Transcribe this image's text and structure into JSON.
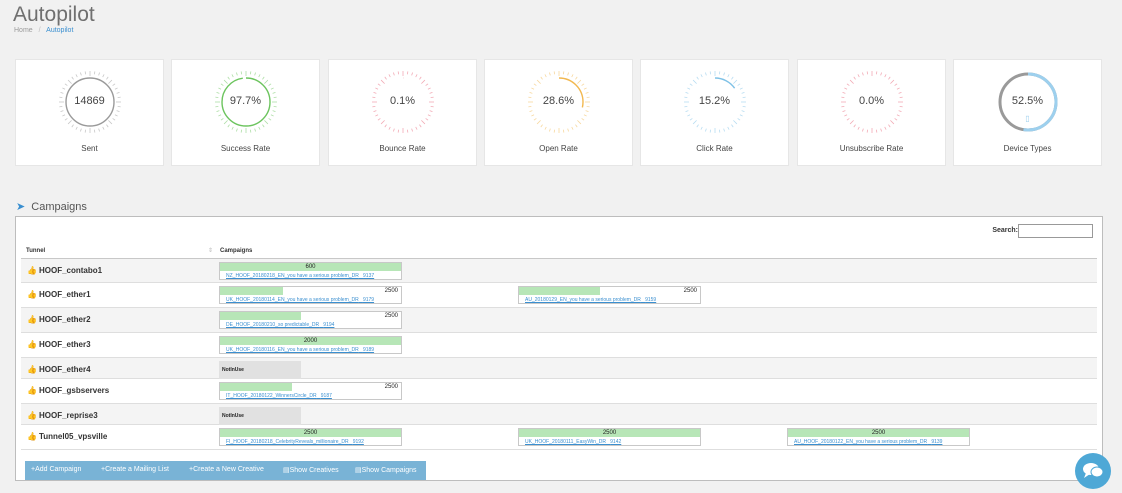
{
  "page": {
    "title": "Autopilot"
  },
  "breadcrumb": {
    "home": "Home",
    "separator": "/",
    "current": "Autopilot"
  },
  "stats": [
    {
      "value": "14869",
      "label": "Sent",
      "color": "#9a9a9a",
      "fill_fraction": 1.0
    },
    {
      "value": "97.7%",
      "label": "Success Rate",
      "color": "#6cc45e",
      "fill_fraction": 0.977
    },
    {
      "value": "0.1%",
      "label": "Bounce Rate",
      "color": "#e8657a",
      "fill_fraction": 0.001
    },
    {
      "value": "28.6%",
      "label": "Open Rate",
      "color": "#f2b84f",
      "fill_fraction": 0.286
    },
    {
      "value": "15.2%",
      "label": "Click Rate",
      "color": "#7ec1e6",
      "fill_fraction": 0.152
    },
    {
      "value": "0.0%",
      "label": "Unsubscribe Rate",
      "color": "#e8657a",
      "fill_fraction": 0.0
    },
    {
      "value": "52.5%",
      "label": "Device Types",
      "color": "#9dd0ee",
      "secondary_color": "#9a9a9a",
      "fill_fraction": 0.525,
      "icon": "mobile-icon"
    }
  ],
  "campaigns_section": {
    "title": "Campaigns",
    "icon": "paper-plane-icon"
  },
  "search": {
    "label": "Search:"
  },
  "table": {
    "headers": {
      "tunnel": "Tunnel",
      "campaigns": "Campaigns"
    },
    "rows": [
      {
        "tunnel": "HOOF_contabo1",
        "campaigns": [
          {
            "count": "600",
            "progress": 1.0,
            "name": "NZ_HOOF_20180218_EN_you have a serious problem_DR",
            "id": "9137"
          }
        ]
      },
      {
        "tunnel": "HOOF_ether1",
        "campaigns": [
          {
            "count": "2500",
            "progress": 0.35,
            "name": "UK_HOOF_20180114_EN_you have a serious problem_DR",
            "id": "9179"
          },
          {
            "count": "2500",
            "progress": 0.45,
            "name": "AU_20180129_EN_you have a serious problem_DR",
            "id": "9159"
          }
        ]
      },
      {
        "tunnel": "HOOF_ether2",
        "campaigns": [
          {
            "count": "2500",
            "progress": 0.45,
            "name": "DE_HOOF_20180210_so predictable_DR",
            "id": "9194"
          }
        ]
      },
      {
        "tunnel": "HOOF_ether3",
        "campaigns": [
          {
            "count": "2000",
            "progress": 1.0,
            "name": "UK_HOOF_20180116_EN_you have a serious problem_DR",
            "id": "9189"
          }
        ]
      },
      {
        "tunnel": "HOOF_ether4",
        "not_in_use": "NotInUse",
        "campaigns": []
      },
      {
        "tunnel": "HOOF_gsbservers",
        "campaigns": [
          {
            "count": "2500",
            "progress": 0.4,
            "name": "IT_HOOF_20180122_WinnersCircle_DR",
            "id": "9187"
          }
        ]
      },
      {
        "tunnel": "HOOF_reprise3",
        "not_in_use": "NotInUse",
        "campaigns": []
      },
      {
        "tunnel": "Tunnel05_vpsville",
        "campaigns": [
          {
            "count": "2500",
            "progress": 1.0,
            "name": "FI_HOOF_20180218_CelebrityReveals_millionaire_DR",
            "id": "9192"
          },
          {
            "count": "2500",
            "progress": 1.0,
            "name": "UK_HOOF_20180111_EasyWin_DR",
            "id": "9142"
          },
          {
            "count": "2500",
            "progress": 1.0,
            "name": "AU_HOOF_20180122_EN_you have a serious problem_DR",
            "id": "9139"
          }
        ]
      }
    ]
  },
  "actions": [
    {
      "label": "+Add Campaign",
      "icon": "plus-icon"
    },
    {
      "label": "+Create a Mailing List",
      "icon": "plus-icon"
    },
    {
      "label": "+Create a New Creative",
      "icon": "plus-icon"
    },
    {
      "label": "Show Creatives",
      "icon": "document-icon"
    },
    {
      "label": "Show Campaigns",
      "icon": "document-icon"
    }
  ],
  "chat": {
    "icon": "chat-bubble-icon"
  }
}
